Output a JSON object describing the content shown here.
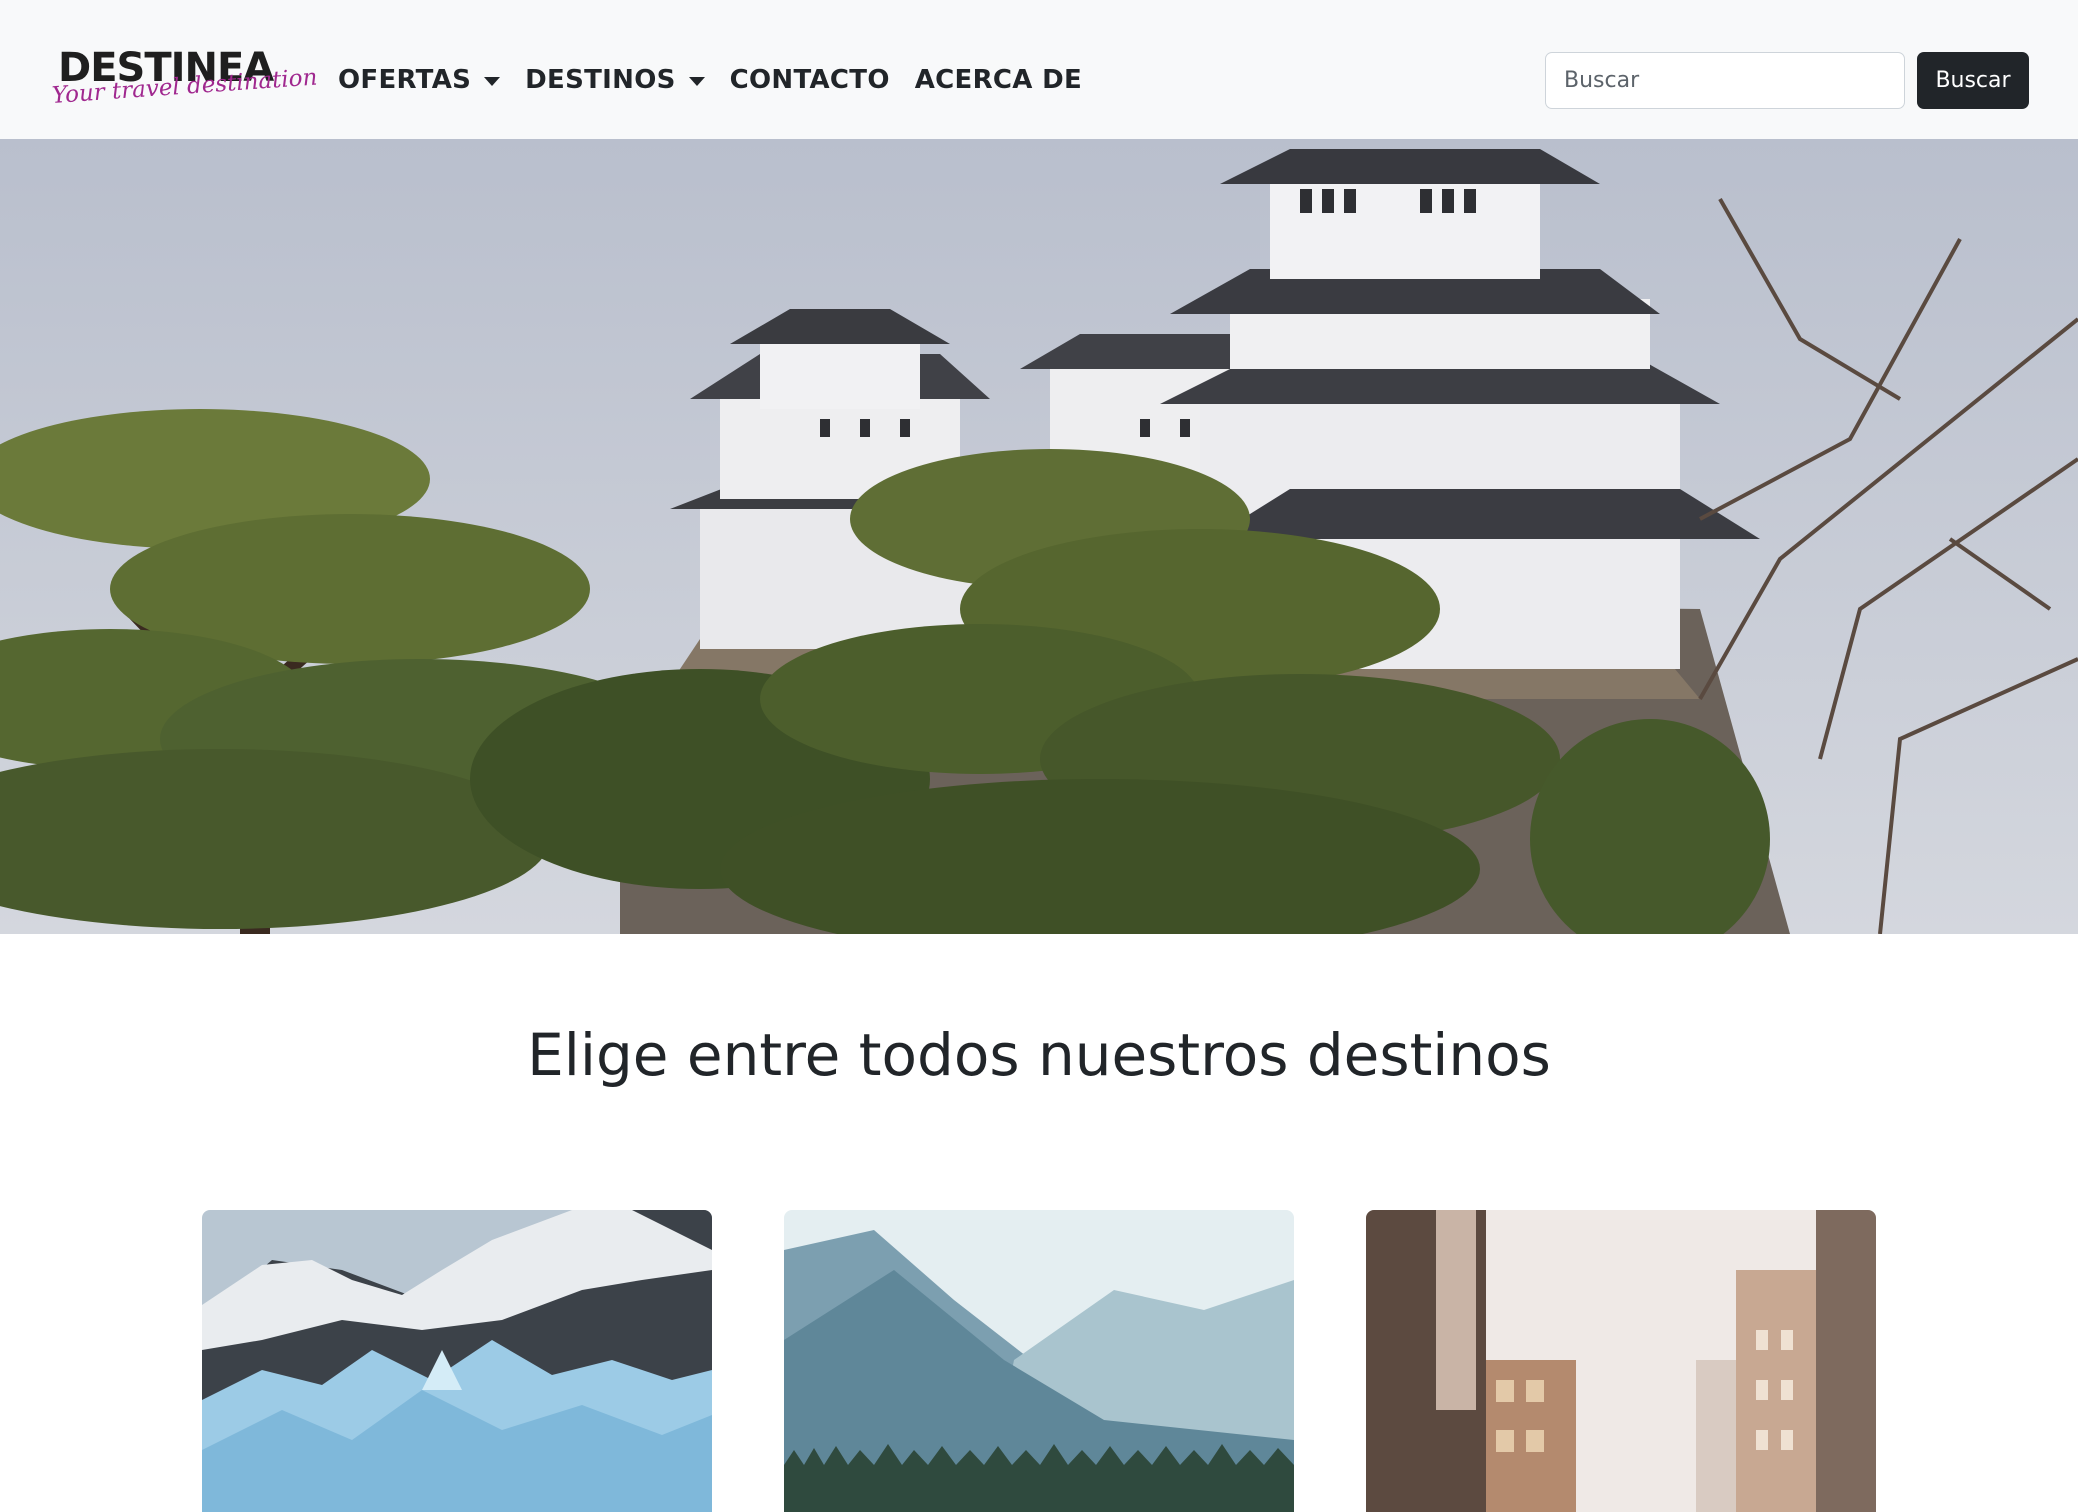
{
  "navbar": {
    "brand": {
      "name": "DESTINEA",
      "tagline": "Your travel destination"
    },
    "links": [
      {
        "label": "OFERTAS",
        "dropdown": true
      },
      {
        "label": "DESTINOS",
        "dropdown": true
      },
      {
        "label": "CONTACTO",
        "dropdown": false
      },
      {
        "label": "ACERCA DE",
        "dropdown": false
      }
    ],
    "search": {
      "placeholder": "Buscar",
      "value": "",
      "button_label": "Buscar"
    }
  },
  "hero": {
    "image": "japanese-castle-with-pine-trees"
  },
  "main": {
    "title": "Elige entre todos nuestros destinos",
    "cards": [
      {
        "image": "glacier-and-snowy-mountains"
      },
      {
        "image": "misty-mountain-valley-with-forest"
      },
      {
        "image": "foggy-city-street-buildings"
      }
    ]
  },
  "colors": {
    "navbar_bg": "#f8f9fa",
    "button_bg": "#212529",
    "text": "#212529",
    "brand_accent": "#a0288f"
  }
}
